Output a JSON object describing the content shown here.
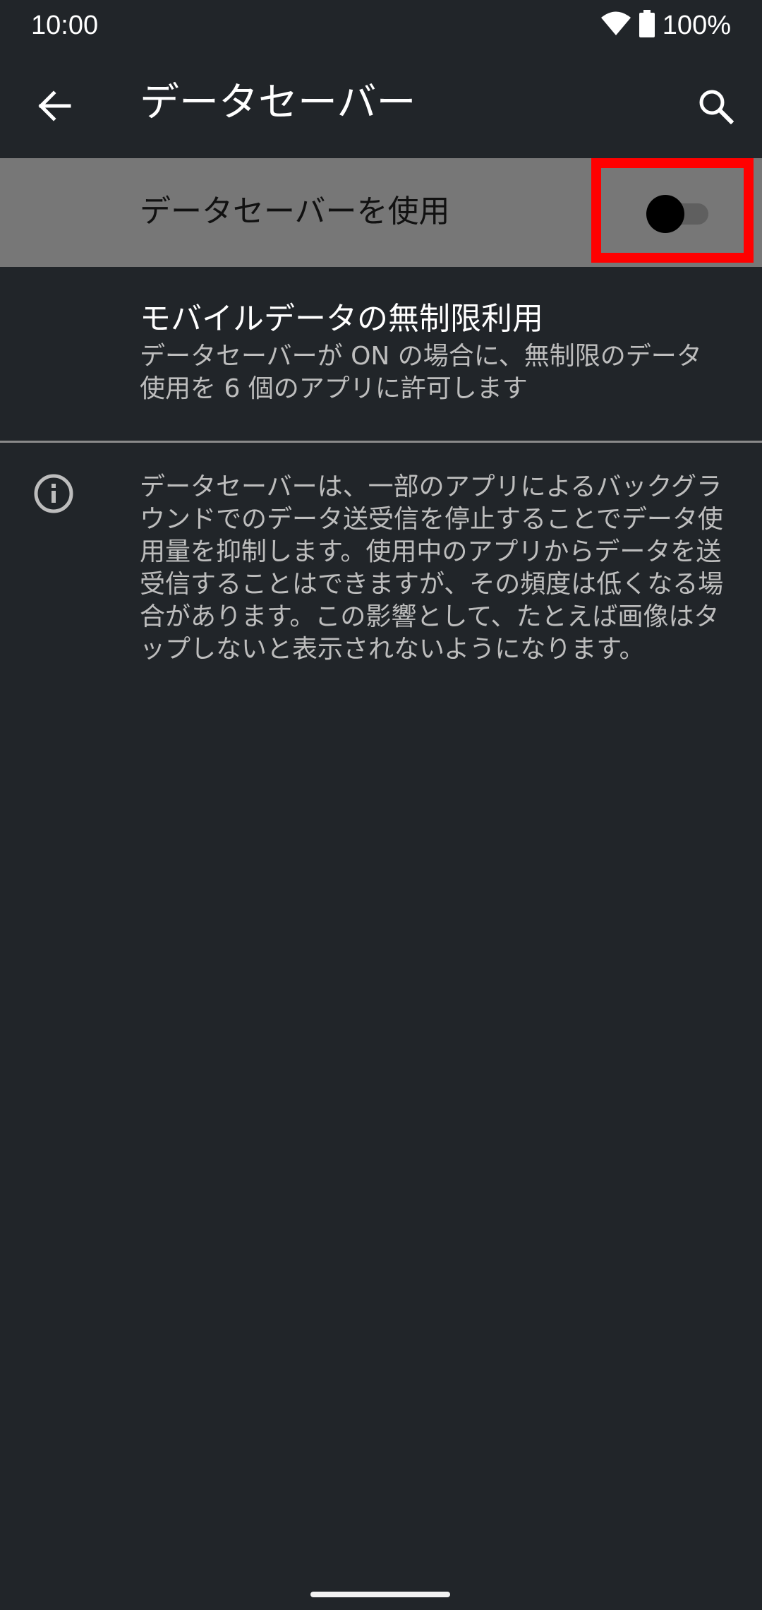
{
  "status_bar": {
    "time": "10:00",
    "battery_text": "100%",
    "icons": [
      "wifi-icon",
      "battery-icon"
    ]
  },
  "app_bar": {
    "title": "データセーバー",
    "back_icon": "arrow-back-icon",
    "search_icon": "search-icon"
  },
  "toggle": {
    "label": "データセーバーを使用",
    "state": "off",
    "highlight_color": "#ff0000"
  },
  "unrestricted": {
    "title": "モバイルデータの無制限利用",
    "summary": "データセーバーが ON の場合に、無制限のデータ使用を 6 個のアプリに許可します"
  },
  "info": {
    "icon": "info-icon",
    "text": "データセーバーは、一部のアプリによるバックグラウンドでのデータ送受信を停止することでデータ使用量を抑制します。使用中のアプリからデータを送受信することはできますが、その頻度は低くなる場合があります。この影響として、たとえば画像はタップしないと表示されないようになります。"
  },
  "colors": {
    "background": "#212529",
    "row_highlight": "#777777",
    "secondary_text": "#bdbdbd"
  }
}
